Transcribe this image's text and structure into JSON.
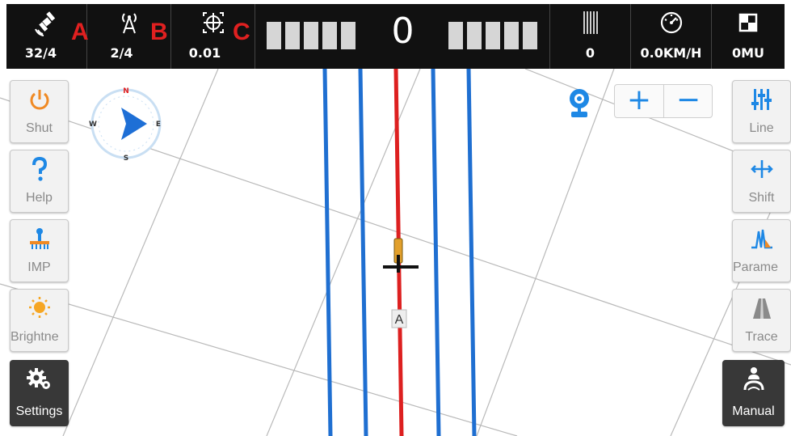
{
  "topbar": {
    "satellites": {
      "icon": "satellite-icon",
      "value": "32/4",
      "tag": "A"
    },
    "base_station": {
      "icon": "antenna-icon",
      "value": "2/4",
      "tag": "B"
    },
    "accuracy": {
      "icon": "target-icon",
      "value": "0.01",
      "tag": "C"
    },
    "offset": {
      "value": "0"
    },
    "line_count": {
      "icon": "rows-icon",
      "value": "0"
    },
    "speed": {
      "icon": "speedometer-icon",
      "value": "0.0KM/H"
    },
    "area": {
      "icon": "area-icon",
      "value": "0MU"
    }
  },
  "compass": {
    "n": "N",
    "s": "S",
    "e": "E",
    "w": "W"
  },
  "left_buttons": [
    {
      "label": "Shut",
      "icon": "power-icon"
    },
    {
      "label": "Help",
      "icon": "help-icon"
    },
    {
      "label": "IMP",
      "icon": "implement-icon"
    },
    {
      "label": "Brightne",
      "icon": "brightness-icon"
    },
    {
      "label": "Settings",
      "icon": "settings-gear-icon"
    }
  ],
  "right_buttons": [
    {
      "label": "Line",
      "icon": "line-icon"
    },
    {
      "label": "Shift",
      "icon": "shift-icon"
    },
    {
      "label": "Parame",
      "icon": "parameter-icon"
    },
    {
      "label": "Trace",
      "icon": "trace-icon"
    },
    {
      "label": "Manual",
      "icon": "steering-wheel-icon"
    }
  ],
  "zoom": {
    "plus": "+",
    "minus": "−"
  },
  "map": {
    "point_label": "A"
  },
  "colors": {
    "guide_line": "#1f6fd1",
    "current_line": "#dd2020",
    "accent": "#1e88e5",
    "tag": "#e02020"
  }
}
